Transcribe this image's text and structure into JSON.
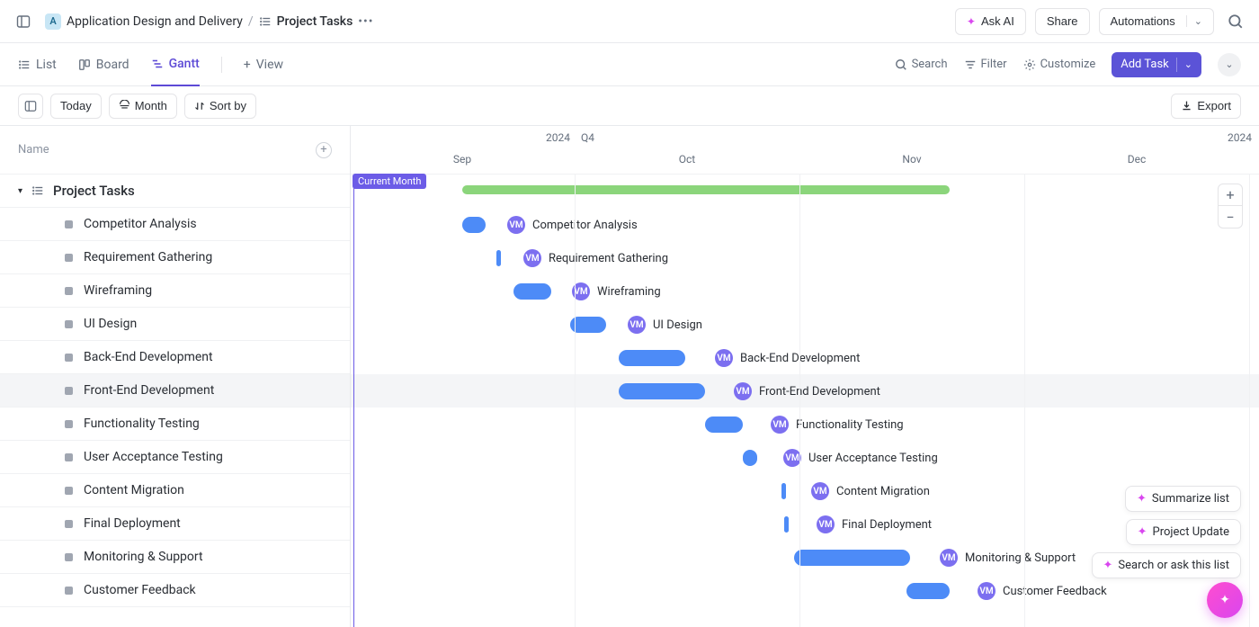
{
  "header": {
    "workspace_initial": "A",
    "workspace_name": "Application Design and Delivery",
    "page_title": "Project Tasks",
    "ask_ai": "Ask AI",
    "share": "Share",
    "automations": "Automations"
  },
  "views": {
    "list": "List",
    "board": "Board",
    "gantt": "Gantt",
    "add_view": "View"
  },
  "viewbar": {
    "search": "Search",
    "filter": "Filter",
    "customize": "Customize",
    "add_task": "Add Task"
  },
  "toolbar": {
    "today": "Today",
    "month": "Month",
    "sort": "Sort by",
    "export": "Export"
  },
  "sidebar": {
    "header": "Name",
    "group_name": "Project Tasks"
  },
  "timeline": {
    "year_left": "2024",
    "quarter": "Q4",
    "year_right": "2024",
    "months": [
      "Sep",
      "Oct",
      "Nov",
      "Dec"
    ],
    "current_label": "Current Month",
    "avatar": "VM"
  },
  "tasks": [
    {
      "name": "Competitor Analysis",
      "start": 124,
      "width": 26,
      "label_x": 174
    },
    {
      "name": "Requirement Gathering",
      "start": 162,
      "width": 5,
      "label_x": 192,
      "thin": true
    },
    {
      "name": "Wireframing",
      "start": 181,
      "width": 42,
      "label_x": 246
    },
    {
      "name": "UI Design",
      "start": 244,
      "width": 40,
      "label_x": 308
    },
    {
      "name": "Back-End Development",
      "start": 298,
      "width": 74,
      "label_x": 405
    },
    {
      "name": "Front-End Development",
      "start": 298,
      "width": 96,
      "label_x": 426,
      "hov": true
    },
    {
      "name": "Functionality Testing",
      "start": 394,
      "width": 42,
      "label_x": 467
    },
    {
      "name": "User Acceptance Testing",
      "start": 436,
      "width": 16,
      "label_x": 481
    },
    {
      "name": "Content Migration",
      "start": 479,
      "width": 5,
      "label_x": 512,
      "thin": true
    },
    {
      "name": "Final Deployment",
      "start": 482,
      "width": 7,
      "label_x": 518,
      "thin": true
    },
    {
      "name": "Monitoring & Support",
      "start": 493,
      "width": 129,
      "label_x": 655
    },
    {
      "name": "Customer Feedback",
      "start": 618,
      "width": 48,
      "label_x": 697
    }
  ],
  "zoom": {
    "in": "+",
    "out": "−"
  },
  "ai_actions": {
    "summarize": "Summarize list",
    "update": "Project Update",
    "search": "Search or ask this list"
  }
}
